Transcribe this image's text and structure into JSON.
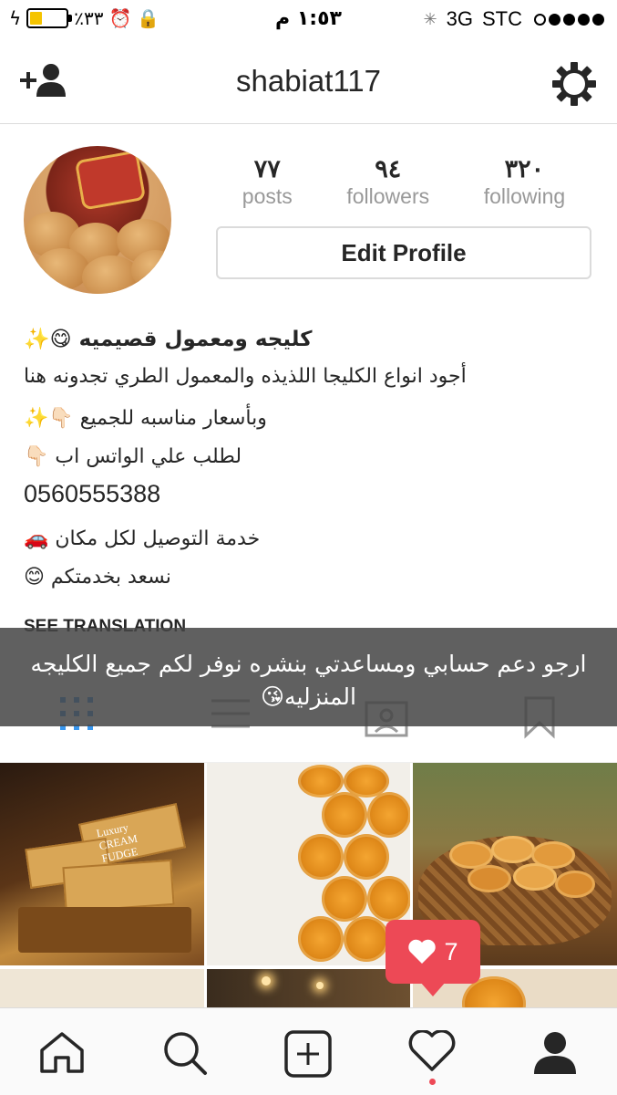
{
  "status_bar": {
    "battery_percent_label": "٪٣٣",
    "time": "١:٥٣ م",
    "network": "3G",
    "carrier": "STC",
    "battery_level": 0.33
  },
  "navbar": {
    "username": "shabiat117",
    "add_person_icon": "add-person-icon",
    "settings_icon": "gear-icon"
  },
  "profile": {
    "posts_count": "٧٧",
    "posts_label": "posts",
    "followers_count": "٩٤",
    "followers_label": "followers",
    "following_count": "٣٢٠",
    "following_label": "following",
    "edit_profile_label": "Edit Profile"
  },
  "bio": {
    "name": "كليجه ومعمول قصيميه 😋✨",
    "line1": "أجود انواع الكليجا اللذيذه والمعمول الطري تجدونه هنا",
    "line2": "وبأسعار مناسبه للجميع 👇🏻✨",
    "line3": "لطلب علي الواتس اب 👇🏻",
    "phone": "0560555388",
    "line4": "خدمة التوصيل لكل مكان 🚗",
    "line5": "نسعد بخدمتكم 😊",
    "see_translation": "SEE TRANSLATION"
  },
  "caption_overlay": {
    "text": "ارجو دعم حسابي ومساعدتي بنشره نوفر لكم جميع الكليجه المنزليه😘"
  },
  "tabs": [
    {
      "name": "grid",
      "icon": "grid-icon",
      "active": true
    },
    {
      "name": "list",
      "icon": "list-icon",
      "active": false
    },
    {
      "name": "tagged",
      "icon": "tagged-photo-icon",
      "active": false
    },
    {
      "name": "saved",
      "icon": "bookmark-icon",
      "active": false
    }
  ],
  "notification": {
    "likes_count": "7",
    "icon": "heart-icon"
  },
  "bottom_nav": [
    {
      "name": "home",
      "icon": "home-icon"
    },
    {
      "name": "search",
      "icon": "search-icon"
    },
    {
      "name": "new-post",
      "icon": "plus-icon"
    },
    {
      "name": "activity",
      "icon": "heart-icon"
    },
    {
      "name": "profile",
      "icon": "person-icon"
    }
  ],
  "grid_images": [
    {
      "text": "Luxury CREAM FUDGE"
    }
  ],
  "colors": {
    "accent_blue": "#3897f0",
    "like_red": "#ed4956",
    "text_primary": "#262626",
    "text_secondary": "#999999"
  }
}
